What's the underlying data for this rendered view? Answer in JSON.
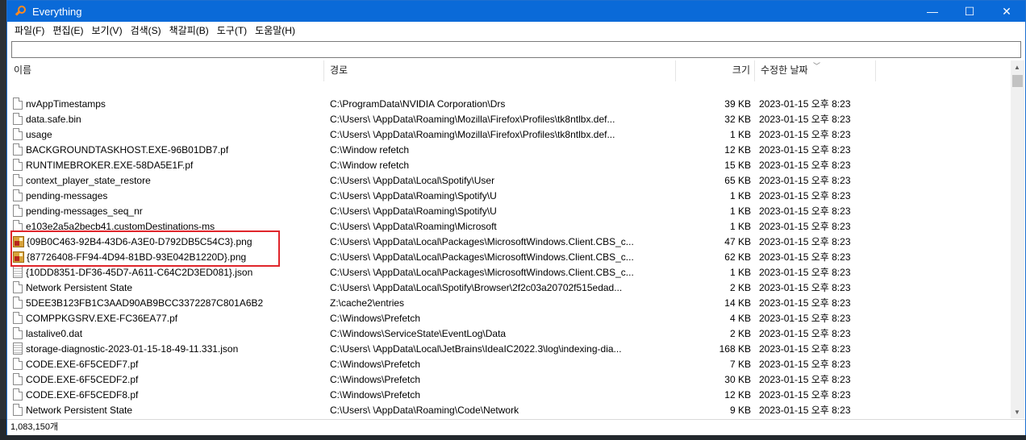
{
  "window": {
    "title": "Everything",
    "minimize": "—",
    "maximize": "☐",
    "close": "✕"
  },
  "menu": [
    "파일(F)",
    "편집(E)",
    "보기(V)",
    "검색(S)",
    "책갈피(B)",
    "도구(T)",
    "도움말(H)"
  ],
  "search": {
    "value": "",
    "placeholder": ""
  },
  "columns": {
    "name": "이름",
    "path": "경로",
    "size": "크기",
    "date": "수정한 날짜"
  },
  "rows": [
    {
      "name": "nvAppTimestamps",
      "path": "C:\\ProgramData\\NVIDIA Corporation\\Drs",
      "size": "39 KB",
      "date": "2023-01-15 오후 8:23",
      "icon": "file-icon"
    },
    {
      "name": "data.safe.bin",
      "path": "C:\\Users\\        \\AppData\\Roaming\\Mozilla\\Firefox\\Profiles\\tk8ntlbx.def...",
      "size": "32 KB",
      "date": "2023-01-15 오후 8:23",
      "icon": "file-icon"
    },
    {
      "name": "usage",
      "path": "C:\\Users\\        \\AppData\\Roaming\\Mozilla\\Firefox\\Profiles\\tk8ntlbx.def...",
      "size": "1 KB",
      "date": "2023-01-15 오후 8:23",
      "icon": "file-icon"
    },
    {
      "name": "BACKGROUNDTASKHOST.EXE-96B01DB7.pf",
      "path": "C:\\Window        refetch",
      "size": "12 KB",
      "date": "2023-01-15 오후 8:23",
      "icon": "file-icon"
    },
    {
      "name": "RUNTIMEBROKER.EXE-58DA5E1F.pf",
      "path": "C:\\Window        refetch",
      "size": "15 KB",
      "date": "2023-01-15 오후 8:23",
      "icon": "file-icon"
    },
    {
      "name": "context_player_state_restore",
      "path": "C:\\Users\\        \\AppData\\Local\\Spotify\\User",
      "size": "65 KB",
      "date": "2023-01-15 오후 8:23",
      "icon": "file-icon"
    },
    {
      "name": "pending-messages",
      "path": "C:\\Users\\        \\AppData\\Roaming\\Spotify\\U",
      "size": "1 KB",
      "date": "2023-01-15 오후 8:23",
      "icon": "file-icon"
    },
    {
      "name": "pending-messages_seq_nr",
      "path": "C:\\Users\\        \\AppData\\Roaming\\Spotify\\U",
      "size": "1 KB",
      "date": "2023-01-15 오후 8:23",
      "icon": "file-icon"
    },
    {
      "name": "e103e2a5a2becb41.customDestinations-ms",
      "path": "C:\\Users\\        \\AppData\\Roaming\\Microsoft",
      "size": "1 KB",
      "date": "2023-01-15 오후 8:23",
      "icon": "file-icon"
    },
    {
      "name": "{09B0C463-92B4-43D6-A3E0-D792DB5C54C3}.png",
      "path": "C:\\Users\\        \\AppData\\Local\\Packages\\MicrosoftWindows.Client.CBS_c...",
      "size": "47 KB",
      "date": "2023-01-15 오후 8:23",
      "icon": "image-icon"
    },
    {
      "name": "{87726408-FF94-4D94-81BD-93E042B1220D}.png",
      "path": "C:\\Users\\        \\AppData\\Local\\Packages\\MicrosoftWindows.Client.CBS_c...",
      "size": "62 KB",
      "date": "2023-01-15 오후 8:23",
      "icon": "image-icon"
    },
    {
      "name": "{10DD8351-DF36-45D7-A611-C64C2D3ED081}.json",
      "path": "C:\\Users\\        \\AppData\\Local\\Packages\\MicrosoftWindows.Client.CBS_c...",
      "size": "1 KB",
      "date": "2023-01-15 오후 8:23",
      "icon": "text-icon"
    },
    {
      "name": "Network Persistent State",
      "path": "C:\\Users\\        \\AppData\\Local\\Spotify\\Browser\\2f2c03a20702f515edad...",
      "size": "2 KB",
      "date": "2023-01-15 오후 8:23",
      "icon": "file-icon"
    },
    {
      "name": "5DEE3B123FB1C3AAD90AB9BCC3372287C801A6B2",
      "path": "Z:\\cache2\\entries",
      "size": "14 KB",
      "date": "2023-01-15 오후 8:23",
      "icon": "file-icon"
    },
    {
      "name": "COMPPKGSRV.EXE-FC36EA77.pf",
      "path": "C:\\Windows\\Prefetch",
      "size": "4 KB",
      "date": "2023-01-15 오후 8:23",
      "icon": "file-icon"
    },
    {
      "name": "lastalive0.dat",
      "path": "C:\\Windows\\ServiceState\\EventLog\\Data",
      "size": "2 KB",
      "date": "2023-01-15 오후 8:23",
      "icon": "file-icon"
    },
    {
      "name": "storage-diagnostic-2023-01-15-18-49-11.331.json",
      "path": "C:\\Users\\        \\AppData\\Local\\JetBrains\\IdeaIC2022.3\\log\\indexing-dia...",
      "size": "168 KB",
      "date": "2023-01-15 오후 8:23",
      "icon": "text-icon"
    },
    {
      "name": "CODE.EXE-6F5CEDF7.pf",
      "path": "C:\\Windows\\Prefetch",
      "size": "7 KB",
      "date": "2023-01-15 오후 8:23",
      "icon": "file-icon"
    },
    {
      "name": "CODE.EXE-6F5CEDF2.pf",
      "path": "C:\\Windows\\Prefetch",
      "size": "30 KB",
      "date": "2023-01-15 오후 8:23",
      "icon": "file-icon"
    },
    {
      "name": "CODE.EXE-6F5CEDF8.pf",
      "path": "C:\\Windows\\Prefetch",
      "size": "12 KB",
      "date": "2023-01-15 오후 8:23",
      "icon": "file-icon"
    },
    {
      "name": "Network Persistent State",
      "path": "C:\\Users\\        \\AppData\\Roaming\\Code\\Network",
      "size": "9 KB",
      "date": "2023-01-15 오후 8:23",
      "icon": "file-icon"
    }
  ],
  "status": {
    "count": "1,083,150개"
  },
  "colors": {
    "titlebar": "#0a6ad8",
    "highlight": "#e0252b",
    "app_icon": "#ff8a1e"
  }
}
